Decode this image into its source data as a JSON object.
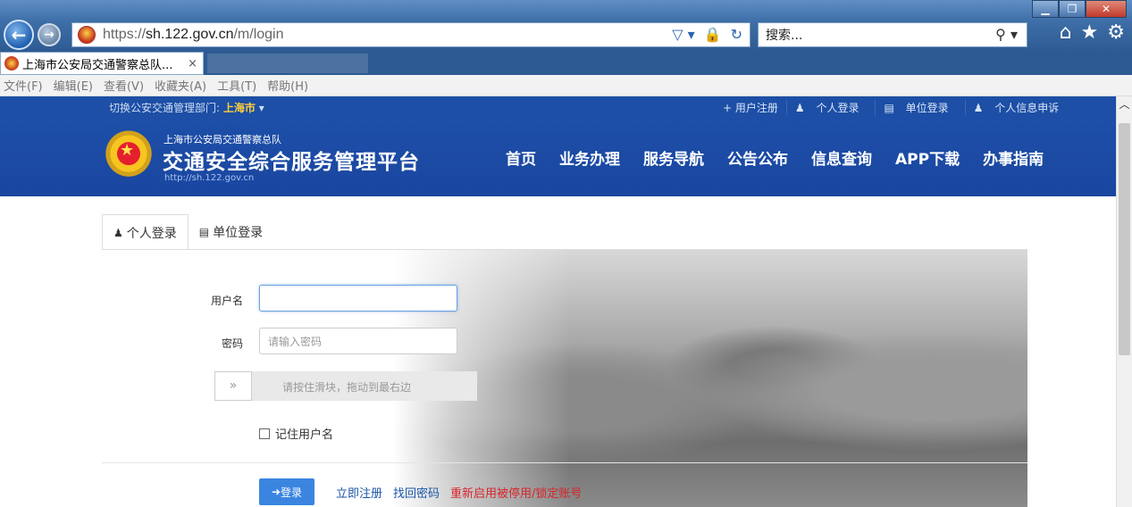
{
  "browser": {
    "url_prefix": "https://",
    "url_host": "sh.122.gov.cn",
    "url_path": "/m/login",
    "search_placeholder": "搜索...",
    "tab_title": "上海市公安局交通警察总队...",
    "menu": [
      "文件(F)",
      "编辑(E)",
      "查看(V)",
      "收藏夹(A)",
      "工具(T)",
      "帮助(H)"
    ]
  },
  "topbar": {
    "region_label": "切换公安交通管理部门:",
    "region_value": "上海市",
    "links": [
      "+ 用户注册",
      "个人登录",
      "单位登录",
      "个人信息申诉"
    ]
  },
  "header": {
    "org": "上海市公安局交通警察总队",
    "title": "交通安全综合服务管理平台",
    "url": "http://sh.122.gov.cn",
    "nav": [
      "首页",
      "业务办理",
      "服务导航",
      "公告公布",
      "信息查询",
      "APP下载",
      "办事指南"
    ]
  },
  "login": {
    "tabs": [
      "个人登录",
      "单位登录"
    ],
    "username_label": "用户名",
    "username_value": "",
    "password_label": "密码",
    "password_placeholder": "请输入密码",
    "slider_text": "请按住滑块，拖动到最右边",
    "slider_handle": "»",
    "remember_label": "记住用户名",
    "login_button": "登录",
    "register_link": "立即注册",
    "recover_link": "找回密码",
    "reactivate_link": "重新启用被停用/锁定账号"
  },
  "colors": {
    "brand_blue": "#1c4fa5",
    "accent_yellow": "#ffcf3a",
    "link_red": "#d9242a",
    "button_blue": "#3b85e0"
  }
}
